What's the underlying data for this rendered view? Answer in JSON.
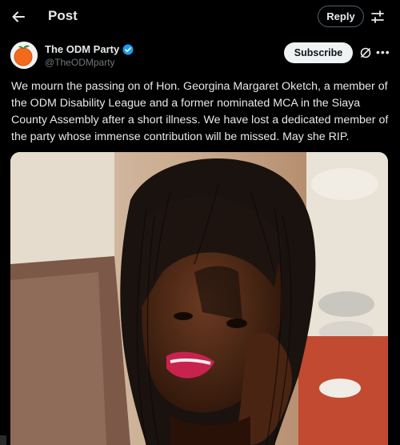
{
  "header": {
    "title": "Post",
    "reply_label": "Reply",
    "back_icon": "arrow-left-icon",
    "tune_icon": "tune-sliders-icon"
  },
  "author": {
    "name": "The ODM Party",
    "handle": "@TheODMparty",
    "verified": true,
    "subscribe_label": "Subscribe",
    "grok_icon": "grok-icon",
    "more_icon": "more-horizontal-icon"
  },
  "post": {
    "text": "We mourn the passing on of Hon. Georgina Margaret Oketch, a member of the ODM Disability League and a former nominated MCA in the Siaya County Assembly after a short illness. We have lost a dedicated member of the party whose immense contribution will be missed. May she RIP."
  },
  "colors": {
    "background": "#000000",
    "text": "#e7e9ea",
    "secondary_text": "#71767b",
    "verified_blue": "#1d9bf0",
    "subscribe_bg": "#eff3f4"
  }
}
